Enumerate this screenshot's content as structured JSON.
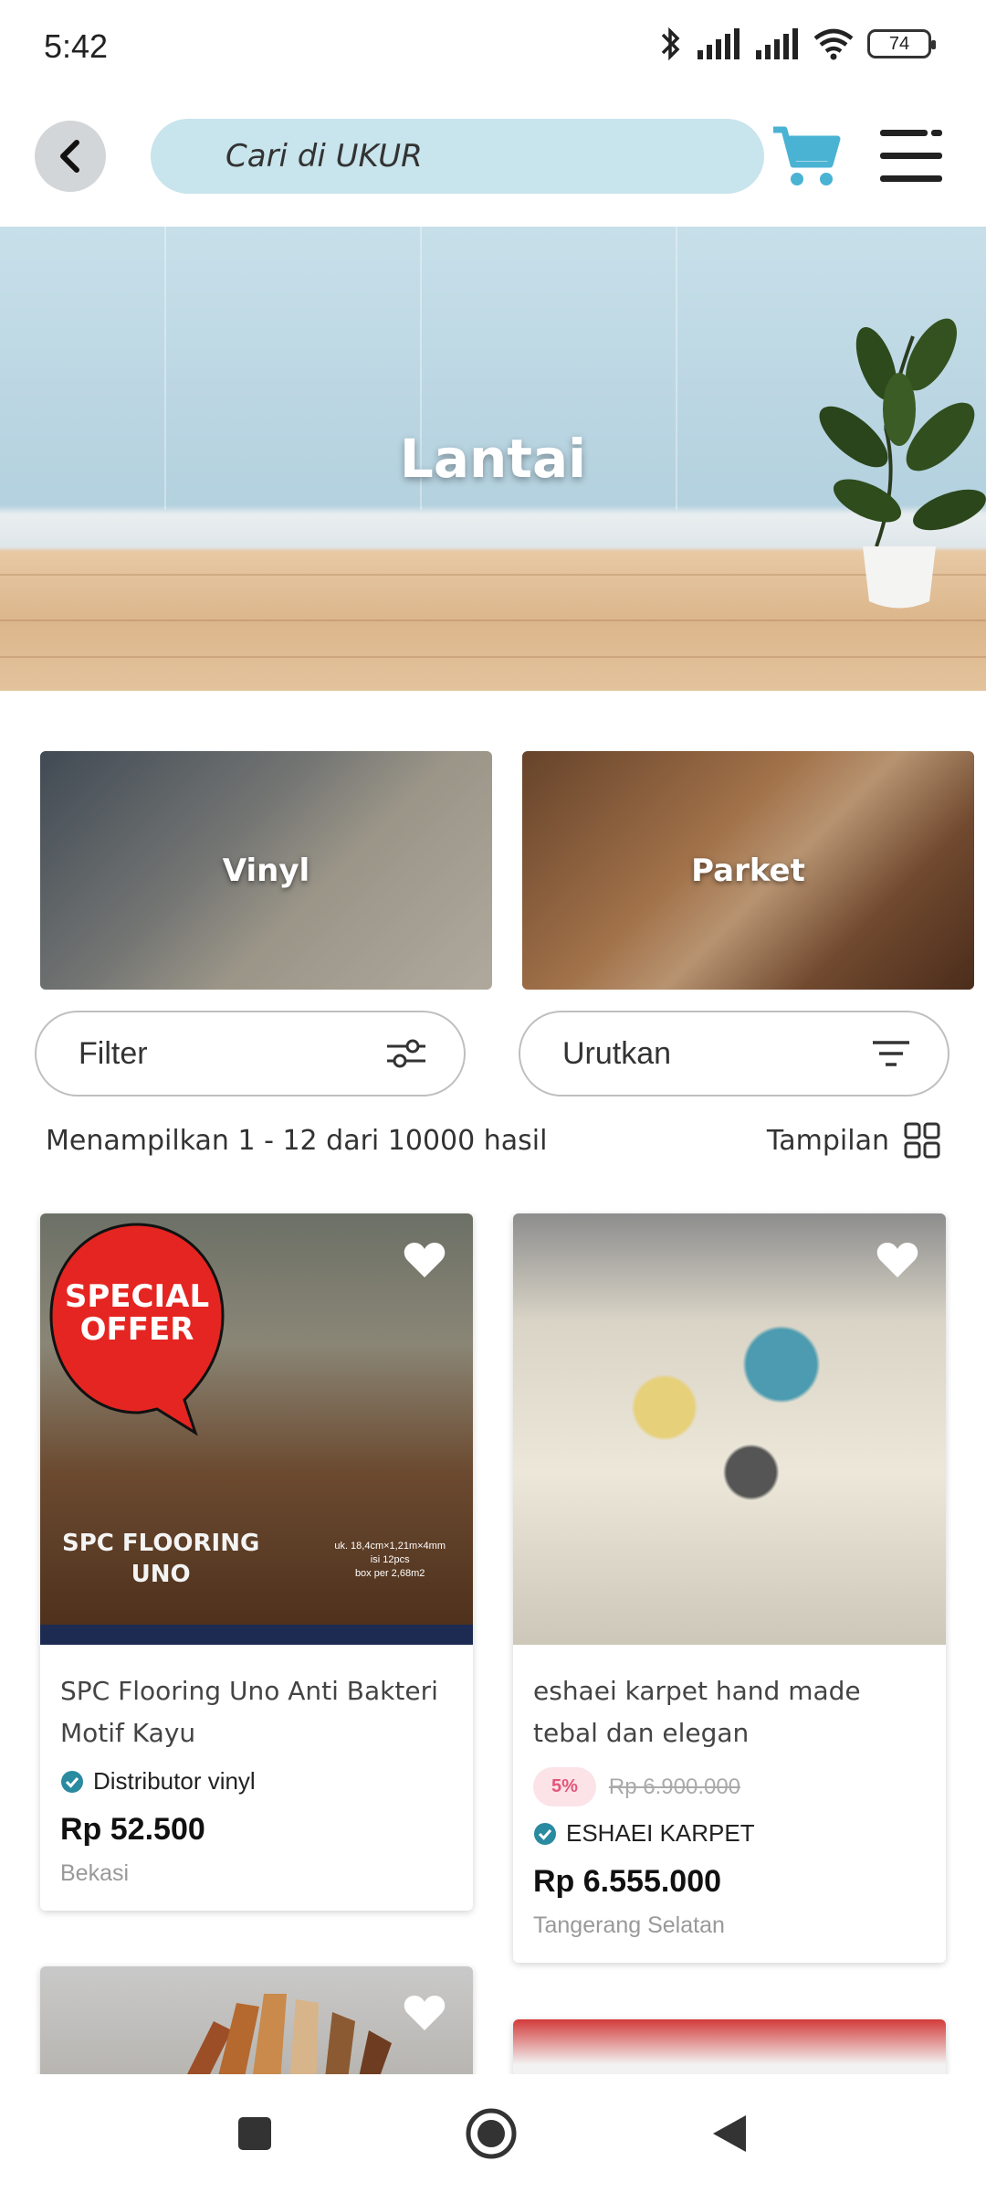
{
  "status_bar": {
    "time": "5:42",
    "battery": "74"
  },
  "header": {
    "search_placeholder": "Cari di UKUR"
  },
  "hero": {
    "title": "Lantai"
  },
  "categories": [
    {
      "label": "Vinyl"
    },
    {
      "label": "Parket"
    }
  ],
  "controls": {
    "filter_label": "Filter",
    "sort_label": "Urutkan"
  },
  "results": {
    "summary": "Menampilkan 1 - 12 dari 10000 hasil",
    "view_label": "Tampilan"
  },
  "products": [
    {
      "title": "SPC Flooring Uno Anti Bakteri Motif Kayu",
      "seller": "Distributor vinyl",
      "price": "Rp 52.500",
      "location": "Bekasi",
      "badge_line1": "SPECIAL",
      "badge_line2": "OFFER",
      "image_text_line1": "SPC FLOORING",
      "image_text_line2": "UNO",
      "image_spec_line1": "uk. 18,4cm×1,21m×4mm",
      "image_spec_line2": "isi 12pcs",
      "image_spec_line3": "box per 2,68m2"
    },
    {
      "title": "eshaei karpet hand made tebal dan elegan",
      "discount": "5%",
      "old_price": "Rp 6.900.000",
      "seller": "ESHAEI KARPET",
      "price": "Rp 6.555.000",
      "location": "Tangerang Selatan"
    }
  ],
  "colors": {
    "accent": "#4ab3d3",
    "search_bg": "#c8e4ec",
    "verified": "#2a8aa0",
    "discount": "#e4567a"
  }
}
